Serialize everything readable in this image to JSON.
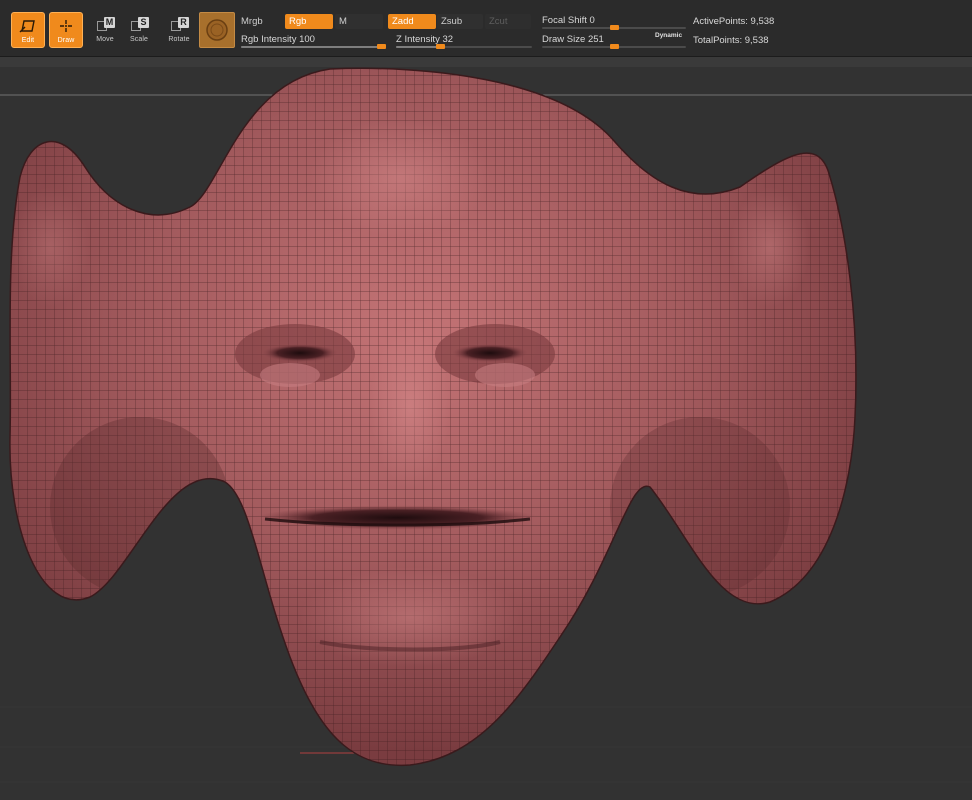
{
  "toolbar": {
    "edit_label": "Edit",
    "draw_label": "Draw",
    "move_label": "Move",
    "move_key": "M",
    "scale_label": "Scale",
    "scale_key": "S",
    "rotate_label": "Rotate",
    "rotate_key": "R"
  },
  "material": {
    "name": "material-swatch",
    "color": "#a8702c"
  },
  "color_mode": {
    "mrgb": "Mrgb",
    "rgb": "Rgb",
    "m": "M",
    "rgb_active": true
  },
  "depth_mode": {
    "zadd": "Zadd",
    "zsub": "Zsub",
    "zcut": "Zcut",
    "zadd_active": true
  },
  "rgb_intensity": {
    "label": "Rgb Intensity",
    "value": "100",
    "fraction": 1.0
  },
  "z_intensity": {
    "label": "Z Intensity",
    "value": "32",
    "fraction": 0.32
  },
  "focal_shift": {
    "label": "Focal Shift",
    "value": "0",
    "fraction": 0.5
  },
  "draw_size": {
    "label": "Draw Size",
    "value": "251",
    "fraction": 0.5,
    "dynamic_label": "Dynamic"
  },
  "stats": {
    "active_points": "ActivePoints: 9,538",
    "total_points": "TotalPoints: 9,538"
  },
  "colors": {
    "accent": "#f08a1c",
    "mesh_base": "#9c5256",
    "mesh_highlight": "#c47476",
    "background": "#323232"
  }
}
